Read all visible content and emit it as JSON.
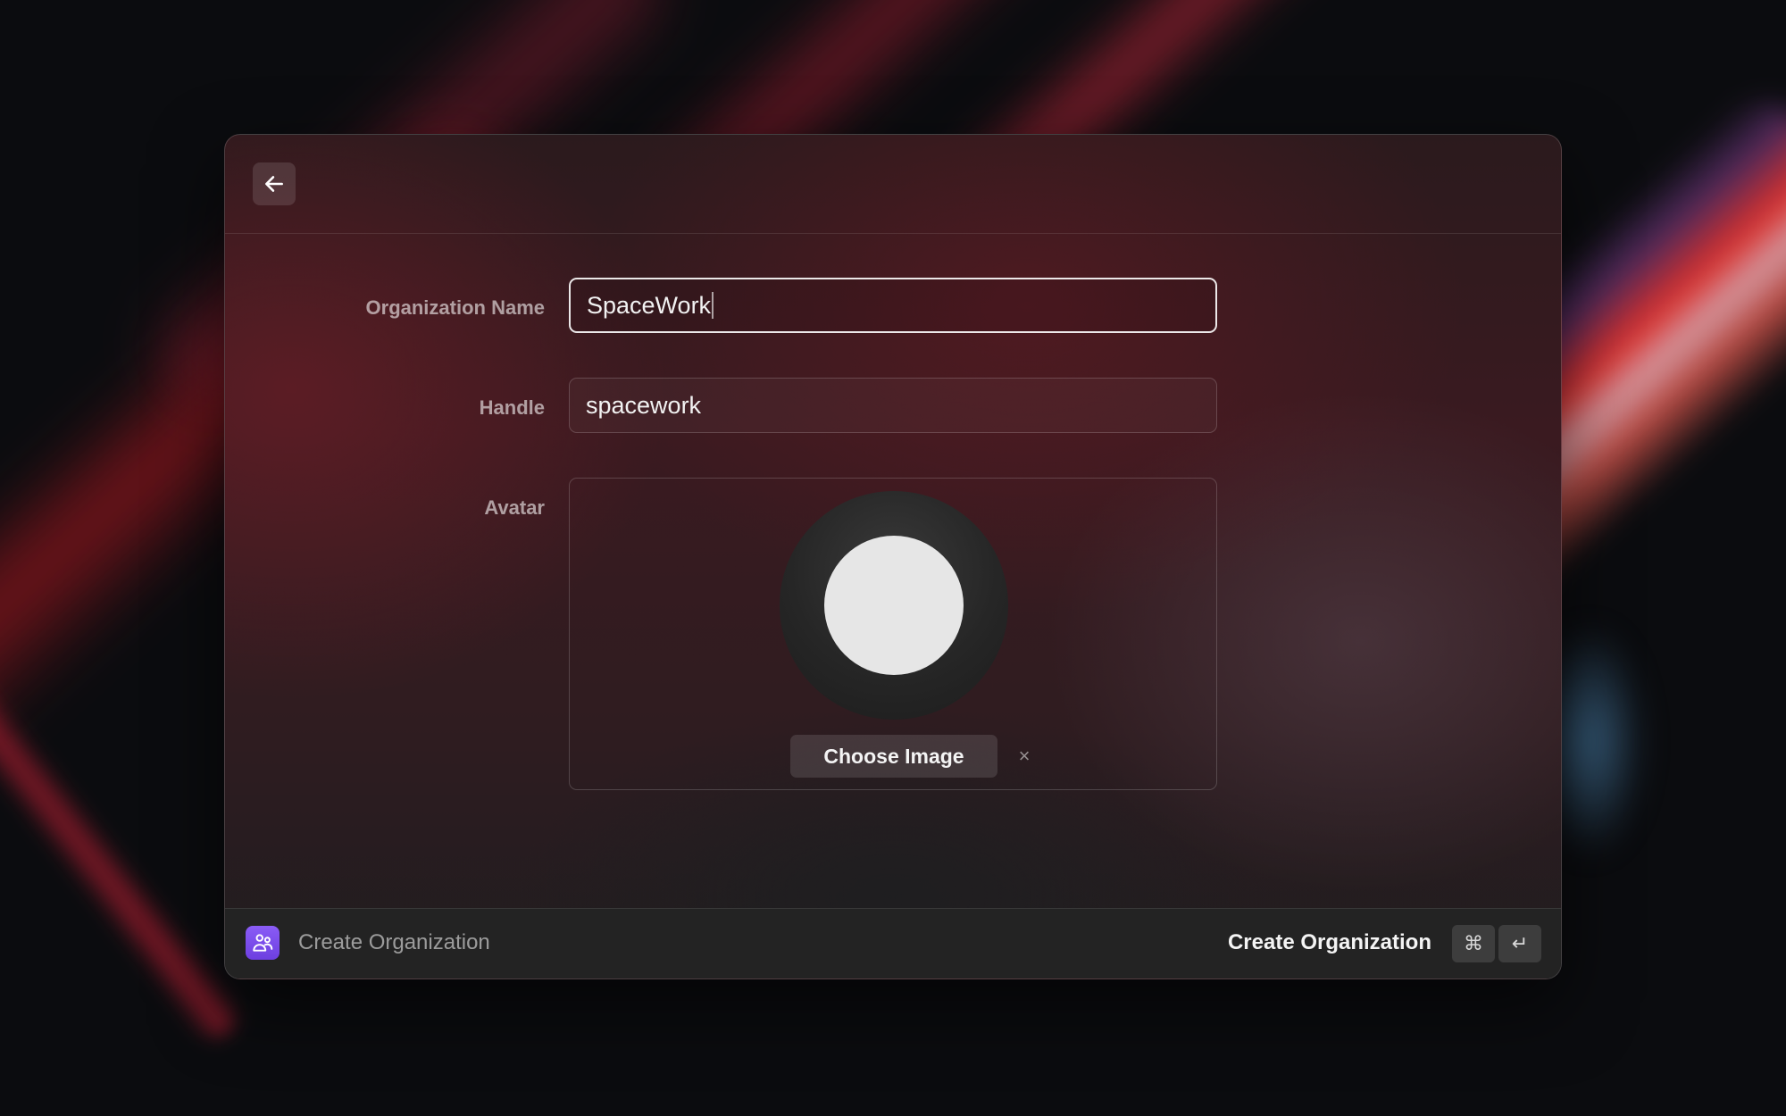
{
  "form": {
    "org_name_label": "Organization Name",
    "org_name_value": "SpaceWork",
    "handle_label": "Handle",
    "handle_value": "spacework",
    "avatar_label": "Avatar",
    "choose_image_label": "Choose Image",
    "clear_label": "×"
  },
  "footer": {
    "title": "Create Organization",
    "action_label": "Create Organization",
    "shortcut_keys": [
      "⌘",
      "↵"
    ]
  },
  "icons": {
    "back": "arrow-left-icon",
    "footer": "organization-icon"
  },
  "colors": {
    "accent": "#7c4dee"
  }
}
